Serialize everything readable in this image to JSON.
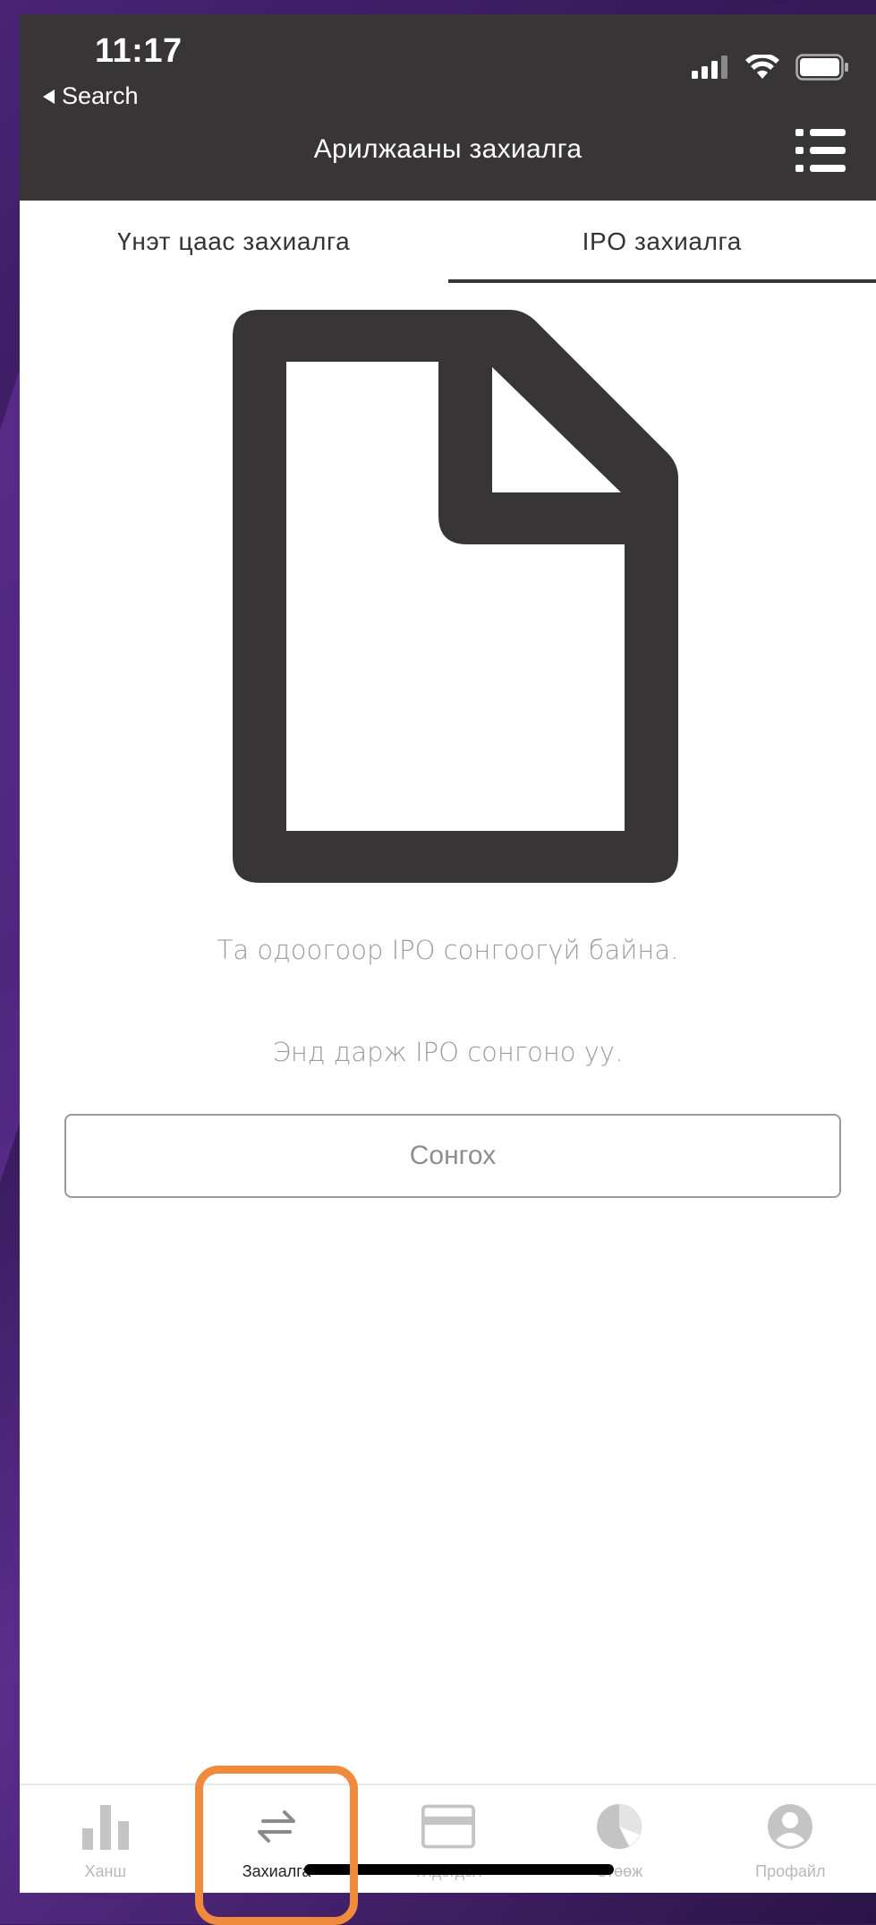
{
  "status_bar": {
    "time": "11:17",
    "back_label": "Search"
  },
  "header": {
    "title": "Арилжааны захиалга"
  },
  "tabs": [
    {
      "label": "Үнэт цаас захиалга",
      "active": false
    },
    {
      "label": "IPO захиалга",
      "active": true
    }
  ],
  "empty_state": {
    "icon": "document-icon",
    "message": "Та одоогоор IPO сонгоогүй байна.",
    "hint": "Энд дарж IPO сонгоно уу.",
    "button_label": "Сонгох"
  },
  "bottom_nav": [
    {
      "label": "Ханш",
      "icon": "bar-chart-icon",
      "active": false
    },
    {
      "label": "Захиалга",
      "icon": "swap-arrows-icon",
      "active": true
    },
    {
      "label": "Үлдэгдэл",
      "icon": "card-icon",
      "active": false
    },
    {
      "label": "Өгөөж",
      "icon": "pie-chart-icon",
      "active": false
    },
    {
      "label": "Профайл",
      "icon": "user-icon",
      "active": false
    }
  ],
  "colors": {
    "header_bg": "#383536",
    "highlight": "#f08a3c",
    "muted_text": "#9c9c9c"
  }
}
